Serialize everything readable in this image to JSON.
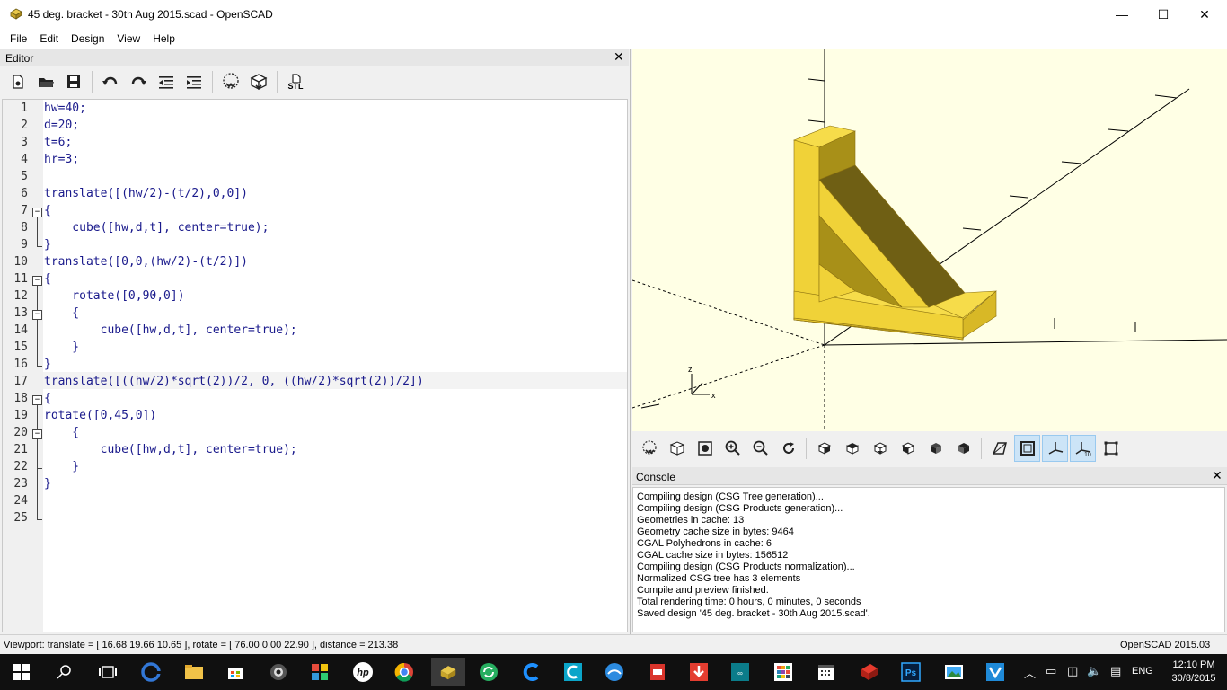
{
  "window": {
    "title": "45 deg. bracket - 30th Aug 2015.scad - OpenSCAD",
    "minimize": "—",
    "maximize": "☐",
    "close": "✕"
  },
  "menu": [
    "File",
    "Edit",
    "Design",
    "View",
    "Help"
  ],
  "editor": {
    "title": "Editor",
    "close": "✕",
    "toolbar": [
      "new-file-icon",
      "open-file-icon",
      "save-icon",
      "undo-icon",
      "redo-icon",
      "unindent-icon",
      "indent-icon",
      "preview-icon",
      "render-icon",
      "export-stl-icon"
    ],
    "stl_label": "STL",
    "line_numbers": [
      "1",
      "2",
      "3",
      "4",
      "5",
      "6",
      "7",
      "8",
      "9",
      "10",
      "11",
      "12",
      "13",
      "14",
      "15",
      "16",
      "17",
      "18",
      "19",
      "20",
      "21",
      "22",
      "23",
      "24",
      "25"
    ],
    "lines": [
      "hw=40;",
      "d=20;",
      "t=6;",
      "hr=3;",
      "",
      "translate([(hw/2)-(t/2),0,0])",
      "{",
      "    cube([hw,d,t], center=true);",
      "}",
      "translate([0,0,(hw/2)-(t/2)])",
      "{",
      "    rotate([0,90,0])",
      "    {",
      "        cube([hw,d,t], center=true);",
      "    }",
      "}",
      "translate([((hw/2)*sqrt(2))/2, 0, ((hw/2)*sqrt(2))/2])",
      "{",
      "rotate([0,45,0])",
      "    {",
      "        cube([hw,d,t], center=true);",
      "    }",
      "}",
      "",
      ""
    ]
  },
  "viewport": {
    "background": "#ffffe5",
    "model_color": "#f2d33a",
    "axis_labels": {
      "x": "x",
      "z": "z"
    }
  },
  "view_toolbar": [
    "preview-icon",
    "render-icon",
    "view-all-icon",
    "zoom-in-icon",
    "zoom-out-icon",
    "reset-view-icon",
    "view-right-icon",
    "view-top-icon",
    "view-bottom-icon",
    "view-left-icon",
    "view-front-icon",
    "view-back-icon",
    "perspective-icon",
    "orthogonal-icon",
    "show-axes-icon",
    "show-scale-markers-icon",
    "show-edges-icon"
  ],
  "console": {
    "title": "Console",
    "close": "✕",
    "lines": [
      "Compiling design (CSG Tree generation)...",
      "Compiling design (CSG Products generation)...",
      "Geometries in cache: 13",
      "Geometry cache size in bytes: 9464",
      "CGAL Polyhedrons in cache: 6",
      "CGAL cache size in bytes: 156512",
      "Compiling design (CSG Products normalization)...",
      "Normalized CSG tree has 3 elements",
      "Compile and preview finished.",
      "Total rendering time: 0 hours, 0 minutes, 0 seconds",
      "Saved design '45 deg. bracket - 30th Aug 2015.scad'."
    ]
  },
  "status": {
    "viewport": "Viewport: translate = [ 16.68 19.66 10.65 ], rotate = [ 76.00 0.00 22.90 ], distance = 213.38",
    "version": "OpenSCAD 2015.03"
  },
  "taskbar": {
    "lang": "ENG",
    "time": "12:10 PM",
    "date": "30/8/2015"
  }
}
